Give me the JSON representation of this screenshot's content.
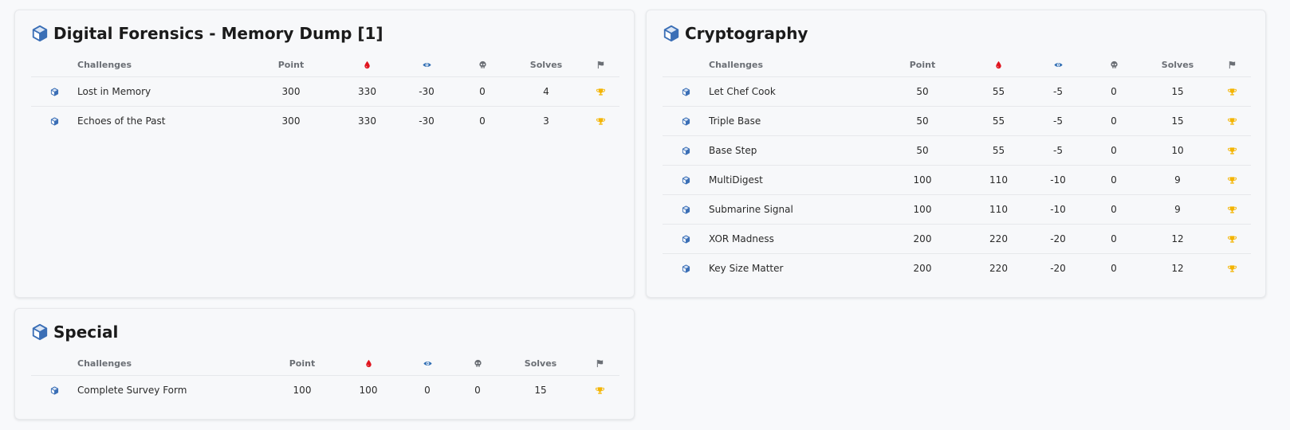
{
  "columns": {
    "challenges": "Challenges",
    "point": "Point",
    "solves": "Solves",
    "first_blood_icon": "blood-drop-icon",
    "view_icon": "eye-icon",
    "hint_icon": "skull-icon",
    "flag_icon": "flag-icon"
  },
  "colors": {
    "cube_icon": "#3b6fb6",
    "blood": "#e0141e",
    "eye": "#2f6db3",
    "trophy": "#f4b400",
    "header_icon_gray": "#6b6f75"
  },
  "cards": [
    {
      "title": "Digital Forensics - Memory Dump [1]",
      "rows": [
        {
          "name": "Lost in Memory",
          "point": "300",
          "blood": "330",
          "view": "-30",
          "hint": "0",
          "solves": "4"
        },
        {
          "name": "Echoes of the Past",
          "point": "300",
          "blood": "330",
          "view": "-30",
          "hint": "0",
          "solves": "3"
        }
      ]
    },
    {
      "title": "Cryptography",
      "rows": [
        {
          "name": "Let Chef Cook",
          "point": "50",
          "blood": "55",
          "view": "-5",
          "hint": "0",
          "solves": "15"
        },
        {
          "name": "Triple Base",
          "point": "50",
          "blood": "55",
          "view": "-5",
          "hint": "0",
          "solves": "15"
        },
        {
          "name": "Base Step",
          "point": "50",
          "blood": "55",
          "view": "-5",
          "hint": "0",
          "solves": "10"
        },
        {
          "name": "MultiDigest",
          "point": "100",
          "blood": "110",
          "view": "-10",
          "hint": "0",
          "solves": "9"
        },
        {
          "name": "Submarine Signal",
          "point": "100",
          "blood": "110",
          "view": "-10",
          "hint": "0",
          "solves": "9"
        },
        {
          "name": "XOR Madness",
          "point": "200",
          "blood": "220",
          "view": "-20",
          "hint": "0",
          "solves": "12"
        },
        {
          "name": "Key Size Matter",
          "point": "200",
          "blood": "220",
          "view": "-20",
          "hint": "0",
          "solves": "12"
        }
      ]
    },
    {
      "title": "Special",
      "rows": [
        {
          "name": "Complete Survey Form",
          "point": "100",
          "blood": "100",
          "view": "0",
          "hint": "0",
          "solves": "15"
        }
      ]
    }
  ]
}
